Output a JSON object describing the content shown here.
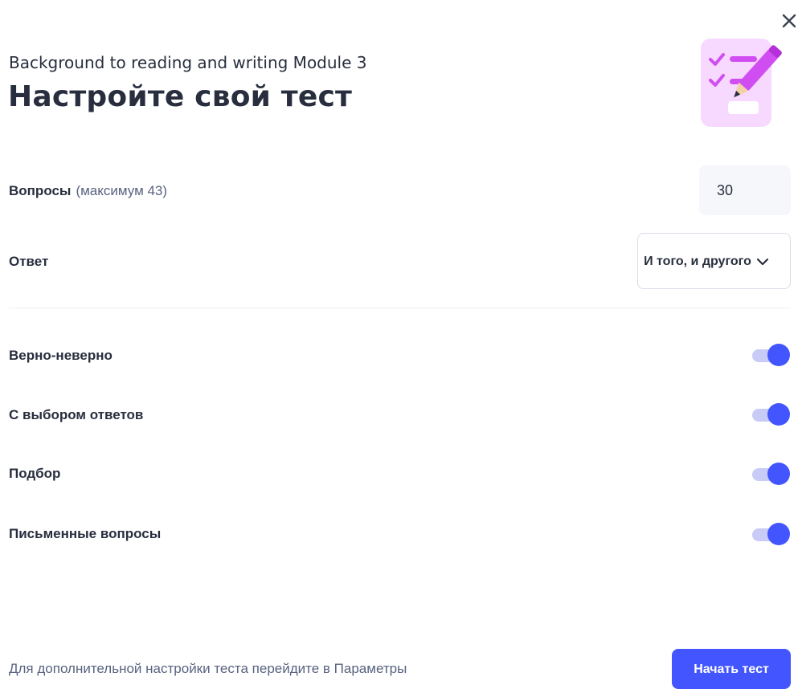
{
  "header": {
    "subtitle": "Background to reading and writing Module 3",
    "title": "Настройте свой тест"
  },
  "icons": {
    "close": "close-icon",
    "hero": "test-checklist-pencil-icon",
    "chevron": "chevron-down-icon"
  },
  "settings": {
    "questions": {
      "label": "Вопросы",
      "hint": "(максимум 43)",
      "value": "30"
    },
    "answer": {
      "label": "Ответ",
      "selected": "И того, и другого"
    },
    "question_types": [
      {
        "label": "Верно-неверно",
        "enabled": true
      },
      {
        "label": "С выбором ответов",
        "enabled": true
      },
      {
        "label": "Подбор",
        "enabled": true
      },
      {
        "label": "Письменные вопросы",
        "enabled": true
      }
    ]
  },
  "footer": {
    "hint": "Для дополнительной настройки теста перейдите в Параметры",
    "start_label": "Начать тест"
  },
  "colors": {
    "accent": "#4255ff",
    "toggle_track": "#c7cbf5",
    "text": "#282e3e",
    "muted": "#586380",
    "hero_bg": "#f7d9ff",
    "hero_accent": "#d04df2"
  }
}
